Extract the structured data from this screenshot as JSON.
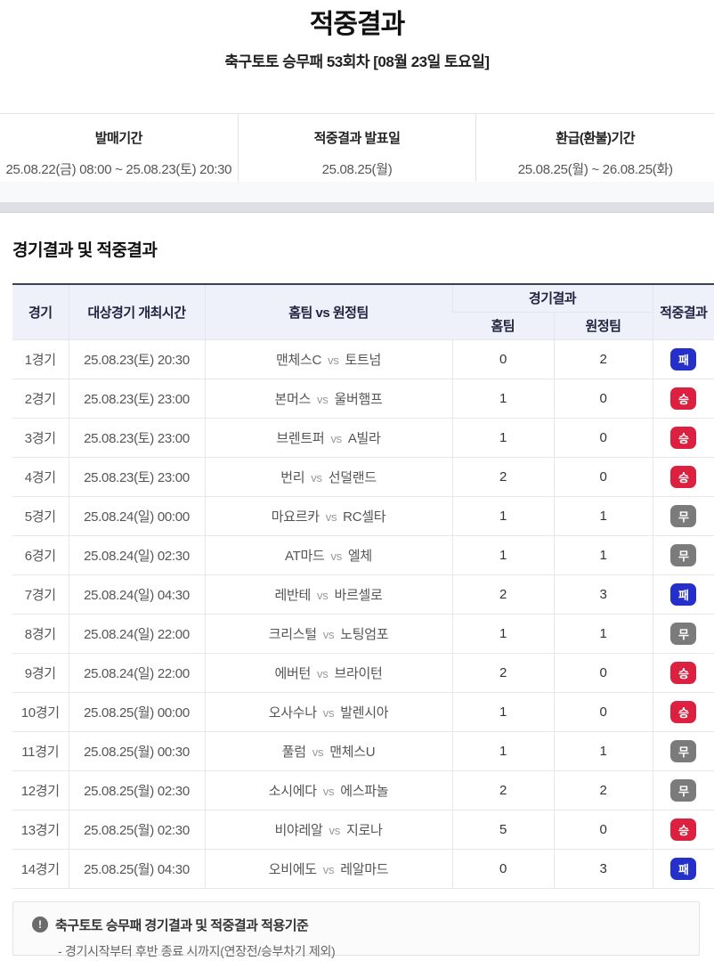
{
  "page": {
    "title": "적중결과",
    "subtitle": "축구토토 승무패 53회차 [08월 23일 토요일]"
  },
  "info_bar": {
    "items": [
      {
        "label": "발매기간",
        "value": "25.08.22(금) 08:00 ~ 25.08.23(토) 20:30"
      },
      {
        "label": "적중결과 발표일",
        "value": "25.08.25(월)"
      },
      {
        "label": "환급(환불)기간",
        "value": "25.08.25(월) ~ 26.08.25(화)"
      }
    ]
  },
  "section": {
    "title": "경기결과 및 적중결과"
  },
  "table": {
    "headers": {
      "match": "경기",
      "time": "대상경기 개최시간",
      "teams": "홈팀 vs 원정팀",
      "result_group": "경기결과",
      "home": "홈팀",
      "away": "원정팀",
      "hit": "적중결과"
    },
    "rows": [
      {
        "match": "1경기",
        "time": "25.08.23(토) 20:30",
        "home_team": "맨체스C",
        "vs": "vs",
        "away_team": "토트넘",
        "home_score": "0",
        "away_score": "2",
        "result": "패",
        "result_type": "lose"
      },
      {
        "match": "2경기",
        "time": "25.08.23(토) 23:00",
        "home_team": "본머스",
        "vs": "vs",
        "away_team": "울버햄프",
        "home_score": "1",
        "away_score": "0",
        "result": "승",
        "result_type": "win"
      },
      {
        "match": "3경기",
        "time": "25.08.23(토) 23:00",
        "home_team": "브렌트퍼",
        "vs": "vs",
        "away_team": "A빌라",
        "home_score": "1",
        "away_score": "0",
        "result": "승",
        "result_type": "win"
      },
      {
        "match": "4경기",
        "time": "25.08.23(토) 23:00",
        "home_team": "번리",
        "vs": "vs",
        "away_team": "선덜랜드",
        "home_score": "2",
        "away_score": "0",
        "result": "승",
        "result_type": "win"
      },
      {
        "match": "5경기",
        "time": "25.08.24(일) 00:00",
        "home_team": "마요르카",
        "vs": "vs",
        "away_team": "RC셀타",
        "home_score": "1",
        "away_score": "1",
        "result": "무",
        "result_type": "draw"
      },
      {
        "match": "6경기",
        "time": "25.08.24(일) 02:30",
        "home_team": "AT마드",
        "vs": "vs",
        "away_team": "엘체",
        "home_score": "1",
        "away_score": "1",
        "result": "무",
        "result_type": "draw"
      },
      {
        "match": "7경기",
        "time": "25.08.24(일) 04:30",
        "home_team": "레반테",
        "vs": "vs",
        "away_team": "바르셀로",
        "home_score": "2",
        "away_score": "3",
        "result": "패",
        "result_type": "lose"
      },
      {
        "match": "8경기",
        "time": "25.08.24(일) 22:00",
        "home_team": "크리스털",
        "vs": "vs",
        "away_team": "노팅엄포",
        "home_score": "1",
        "away_score": "1",
        "result": "무",
        "result_type": "draw"
      },
      {
        "match": "9경기",
        "time": "25.08.24(일) 22:00",
        "home_team": "에버턴",
        "vs": "vs",
        "away_team": "브라이턴",
        "home_score": "2",
        "away_score": "0",
        "result": "승",
        "result_type": "win"
      },
      {
        "match": "10경기",
        "time": "25.08.25(월) 00:00",
        "home_team": "오사수나",
        "vs": "vs",
        "away_team": "발렌시아",
        "home_score": "1",
        "away_score": "0",
        "result": "승",
        "result_type": "win"
      },
      {
        "match": "11경기",
        "time": "25.08.25(월) 00:30",
        "home_team": "풀럼",
        "vs": "vs",
        "away_team": "맨체스U",
        "home_score": "1",
        "away_score": "1",
        "result": "무",
        "result_type": "draw"
      },
      {
        "match": "12경기",
        "time": "25.08.25(월) 02:30",
        "home_team": "소시에다",
        "vs": "vs",
        "away_team": "에스파놀",
        "home_score": "2",
        "away_score": "2",
        "result": "무",
        "result_type": "draw"
      },
      {
        "match": "13경기",
        "time": "25.08.25(월) 02:30",
        "home_team": "비야레알",
        "vs": "vs",
        "away_team": "지로나",
        "home_score": "5",
        "away_score": "0",
        "result": "승",
        "result_type": "win"
      },
      {
        "match": "14경기",
        "time": "25.08.25(월) 04:30",
        "home_team": "오비에도",
        "vs": "vs",
        "away_team": "레알마드",
        "home_score": "0",
        "away_score": "3",
        "result": "패",
        "result_type": "lose"
      }
    ]
  },
  "footer_note": {
    "icon": "exclamation-icon",
    "icon_glyph": "!",
    "title": "축구토토 승무패 경기결과 및 적중결과 적용기준",
    "line": "- 경기시작부터 후반 종료 시까지(연장전/승부차기 제외)"
  },
  "colors": {
    "win": "#dc2140",
    "draw": "#7b7b7b",
    "lose": "#2430c9",
    "header_bg": "#eef0fa",
    "table_top_border": "#3c4250"
  }
}
